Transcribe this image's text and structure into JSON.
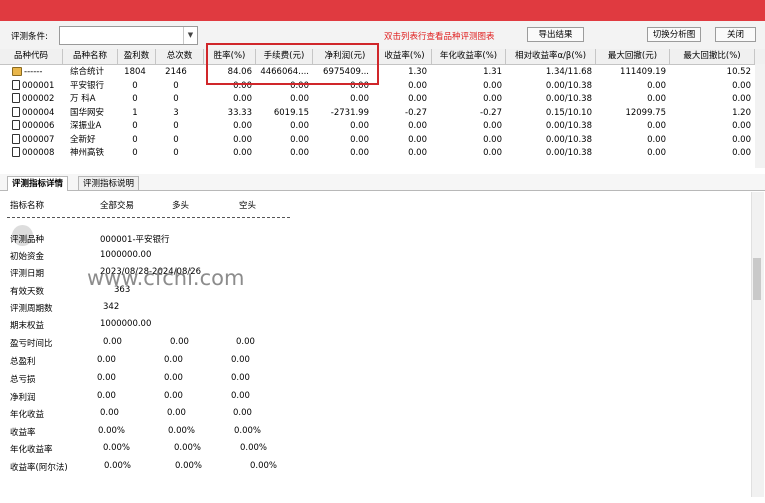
{
  "toolbar": {
    "condition_label": "评测条件:",
    "hint": "双击列表行查看品种评测图表",
    "export_button": "导出结果",
    "switch_button": "切换分析图",
    "close_button": "关闭"
  },
  "table": {
    "columns": [
      "品种代码",
      "品种名称",
      "盈利数",
      "总次数",
      "胜率(%)",
      "手续费(元)",
      "净利润(元)",
      "收益率(%)",
      "年化收益率(%)",
      "相对收益率α/β(%)",
      "最大回撤(元)",
      "最大回撤比(%)"
    ],
    "rows": [
      {
        "code": "------",
        "name": "综合统计",
        "profit_count": "1804",
        "total": "2146",
        "win_rate": "84.06",
        "fee": "4466064....",
        "net_profit": "6975409...",
        "return": "1.30",
        "annual": "1.31",
        "relative": "1.34/11.68",
        "max_dd": "111409.19",
        "max_dd_ratio": "10.52",
        "icon": "summary-icon"
      },
      {
        "code": "000001",
        "name": "平安银行",
        "profit_count": "0",
        "total": "0",
        "win_rate": "0.00",
        "fee": "0.00",
        "net_profit": "0.00",
        "return": "0.00",
        "annual": "0.00",
        "relative": "0.00/10.38",
        "max_dd": "0.00",
        "max_dd_ratio": "0.00",
        "icon": "file-icon"
      },
      {
        "code": "000002",
        "name": "万 科A",
        "profit_count": "0",
        "total": "0",
        "win_rate": "0.00",
        "fee": "0.00",
        "net_profit": "0.00",
        "return": "0.00",
        "annual": "0.00",
        "relative": "0.00/10.38",
        "max_dd": "0.00",
        "max_dd_ratio": "0.00",
        "icon": "file-icon"
      },
      {
        "code": "000004",
        "name": "国华网安",
        "profit_count": "1",
        "total": "3",
        "win_rate": "33.33",
        "fee": "6019.15",
        "net_profit": "-2731.99",
        "return": "-0.27",
        "annual": "-0.27",
        "relative": "0.15/10.10",
        "max_dd": "12099.75",
        "max_dd_ratio": "1.20",
        "icon": "file-icon"
      },
      {
        "code": "000006",
        "name": "深振业A",
        "profit_count": "0",
        "total": "0",
        "win_rate": "0.00",
        "fee": "0.00",
        "net_profit": "0.00",
        "return": "0.00",
        "annual": "0.00",
        "relative": "0.00/10.38",
        "max_dd": "0.00",
        "max_dd_ratio": "0.00",
        "icon": "file-icon"
      },
      {
        "code": "000007",
        "name": "全新好",
        "profit_count": "0",
        "total": "0",
        "win_rate": "0.00",
        "fee": "0.00",
        "net_profit": "0.00",
        "return": "0.00",
        "annual": "0.00",
        "relative": "0.00/10.38",
        "max_dd": "0.00",
        "max_dd_ratio": "0.00",
        "icon": "file-icon"
      },
      {
        "code": "000008",
        "name": "神州高铁",
        "profit_count": "0",
        "total": "0",
        "win_rate": "0.00",
        "fee": "0.00",
        "net_profit": "0.00",
        "return": "0.00",
        "annual": "0.00",
        "relative": "0.00/10.38",
        "max_dd": "0.00",
        "max_dd_ratio": "0.00",
        "icon": "file-icon"
      }
    ]
  },
  "tabs": [
    "评测指标详情",
    "评测指标说明"
  ],
  "detail": {
    "headers": [
      "指标名称",
      "全部交易",
      "多头",
      "空头"
    ],
    "items": [
      {
        "label": "评测品种",
        "v1": "000001-平安银行",
        "v2": "",
        "v3": ""
      },
      {
        "label": "初始资金",
        "v1": "1000000.00",
        "v2": "",
        "v3": ""
      },
      {
        "label": "评测日期",
        "v1": "2023/08/28-2024/08/26",
        "v2": "",
        "v3": ""
      },
      {
        "label": "有效天数",
        "v1": "363",
        "v2": "",
        "v3": ""
      },
      {
        "label": "评测周期数",
        "v1": "342",
        "v2": "",
        "v3": ""
      },
      {
        "label": "期末权益",
        "v1": "1000000.00",
        "v2": "",
        "v3": ""
      },
      {
        "label": "盈亏时间比",
        "v1": "0.00",
        "v2": "0.00",
        "v3": "0.00"
      },
      {
        "label": "总盈利",
        "v1": "0.00",
        "v2": "0.00",
        "v3": "0.00"
      },
      {
        "label": "总亏损",
        "v1": "0.00",
        "v2": "0.00",
        "v3": "0.00"
      },
      {
        "label": "净利润",
        "v1": "0.00",
        "v2": "0.00",
        "v3": "0.00"
      },
      {
        "label": "年化收益",
        "v1": "0.00",
        "v2": "0.00",
        "v3": "0.00"
      },
      {
        "label": "收益率",
        "v1": "0.00%",
        "v2": "0.00%",
        "v3": "0.00%"
      },
      {
        "label": "年化收益率",
        "v1": "0.00%",
        "v2": "0.00%",
        "v3": "0.00%"
      },
      {
        "label": "收益率(阿尔法)",
        "v1": "0.00%",
        "v2": "0.00%",
        "v3": "0.00%"
      }
    ]
  },
  "watermark": "www.cfchi.com",
  "colors": {
    "accent_bar": "#e03a40",
    "hint_text": "#e02020",
    "highlight_box": "#d0262a"
  }
}
